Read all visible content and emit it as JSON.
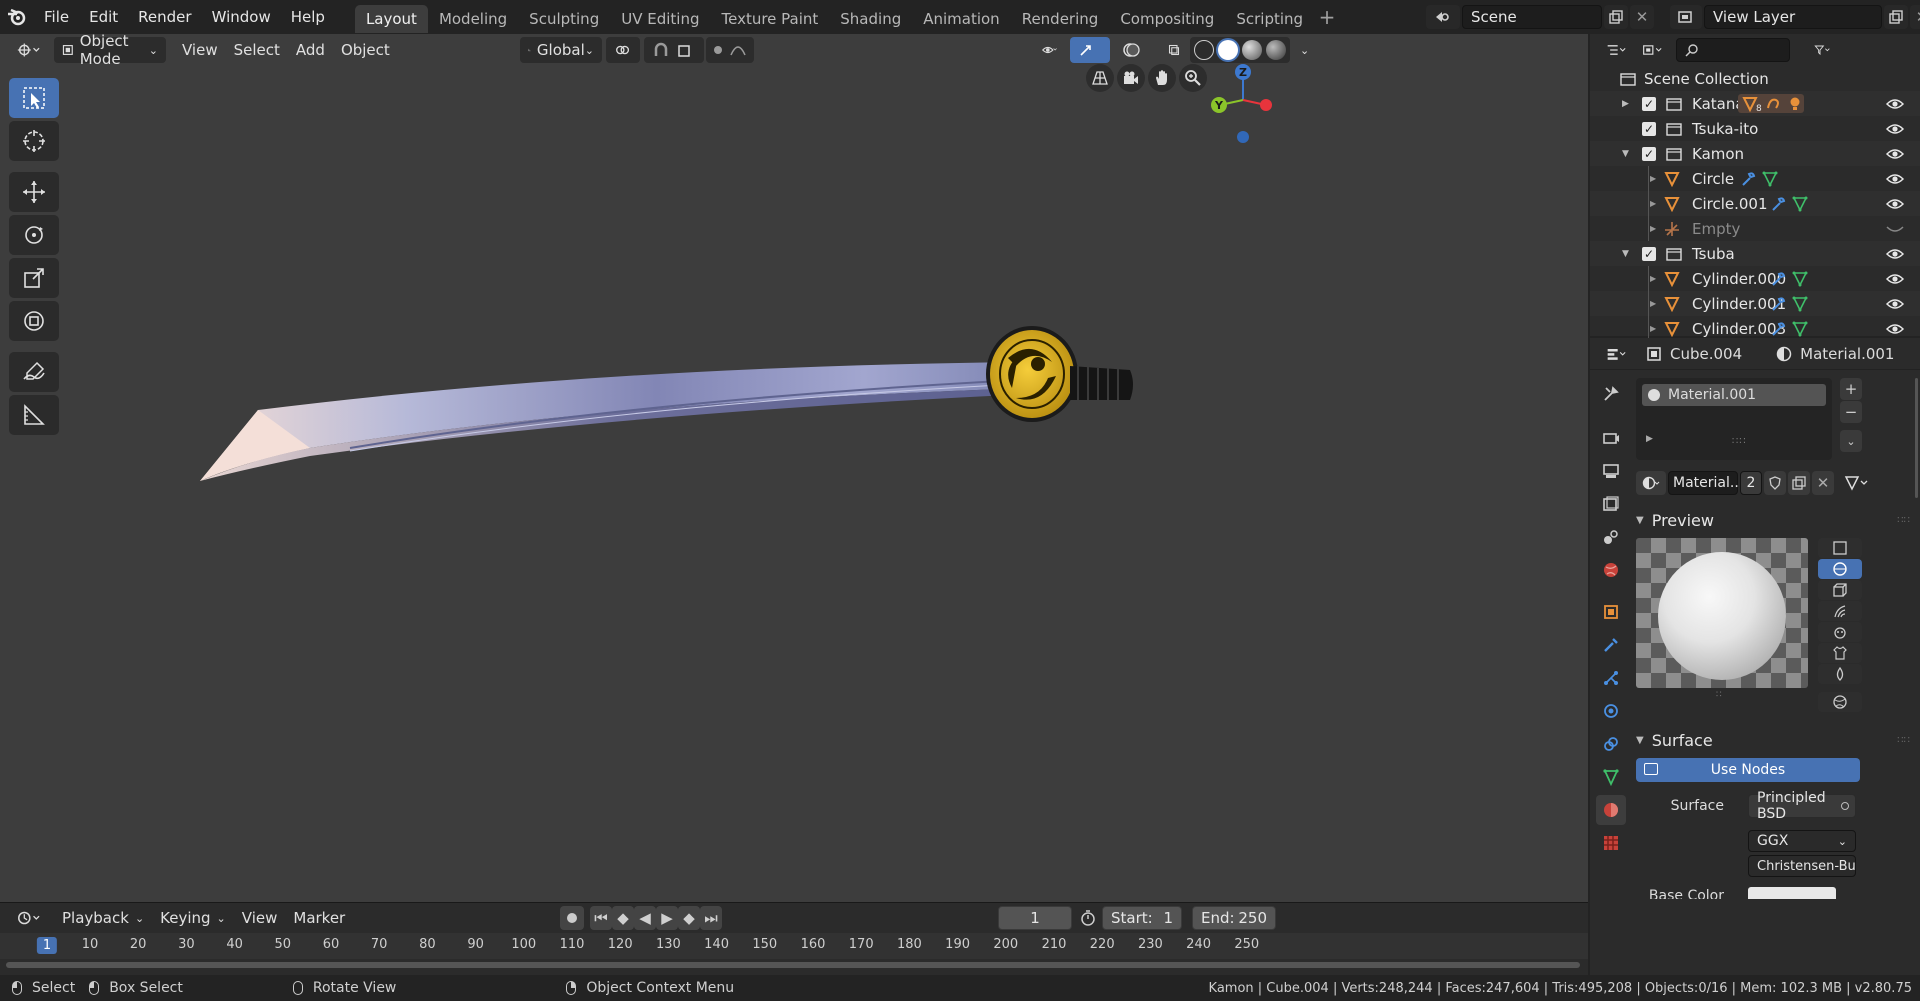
{
  "menus": [
    "File",
    "Edit",
    "Render",
    "Window",
    "Help"
  ],
  "workspaces": [
    "Layout",
    "Modeling",
    "Sculpting",
    "UV Editing",
    "Texture Paint",
    "Shading",
    "Animation",
    "Rendering",
    "Compositing",
    "Scripting"
  ],
  "active_workspace": "Layout",
  "scene": {
    "label": "Scene"
  },
  "view_layer": {
    "label": "View Layer"
  },
  "viewport_header": {
    "mode": "Object Mode",
    "menus": [
      "View",
      "Select",
      "Add",
      "Object"
    ],
    "transform_orientation": "Global"
  },
  "gizmo": {
    "z": "Z",
    "y": "Y"
  },
  "outliner": {
    "root": "Scene Collection",
    "rows": [
      {
        "label": "Katana",
        "level": 0,
        "type": "collection",
        "expand": "closed",
        "badge": "8"
      },
      {
        "label": "Tsuka-ito",
        "level": 0,
        "type": "collection",
        "expand": "none"
      },
      {
        "label": "Kamon",
        "level": 0,
        "type": "collection",
        "expand": "open"
      },
      {
        "label": "Circle",
        "level": 1,
        "type": "mesh"
      },
      {
        "label": "Circle.001",
        "level": 1,
        "type": "mesh"
      },
      {
        "label": "Empty",
        "level": 1,
        "type": "empty"
      },
      {
        "label": "Tsuba",
        "level": 0,
        "type": "collection",
        "expand": "open"
      },
      {
        "label": "Cylinder.000",
        "level": 1,
        "type": "mesh"
      },
      {
        "label": "Cylinder.001",
        "level": 1,
        "type": "mesh"
      },
      {
        "label": "Cylinder.003",
        "level": 1,
        "type": "mesh"
      }
    ]
  },
  "properties": {
    "object": "Cube.004",
    "material": "Material.001",
    "slot": "Material.001",
    "mat_name": "Material...",
    "users": "2",
    "preview_label": "Preview",
    "surface_label": "Surface",
    "use_nodes": "Use Nodes",
    "surface_field_label": "Surface",
    "surface_value": "Principled BSD",
    "distribution": "GGX",
    "subsurface": "Christensen-Bu...",
    "base_color_label": "Base Color"
  },
  "timeline": {
    "menus": [
      "Playback",
      "Keying",
      "View",
      "Marker"
    ],
    "current_frame": "1",
    "start_label": "Start:",
    "start": "1",
    "end_label": "End:",
    "end": "250",
    "ticks": [
      "1",
      "10",
      "20",
      "30",
      "40",
      "50",
      "60",
      "70",
      "80",
      "90",
      "100",
      "110",
      "120",
      "130",
      "140",
      "150",
      "160",
      "170",
      "180",
      "190",
      "200",
      "210",
      "220",
      "230",
      "240",
      "250"
    ]
  },
  "status": {
    "select": "Select",
    "box_select": "Box Select",
    "rotate": "Rotate View",
    "context": "Object Context Menu",
    "info": "Kamon | Cube.004 | Verts:248,244 | Faces:247,604 | Tris:495,208 | Objects:0/16 | Mem: 102.3 MB | v2.80.75"
  },
  "colors": {
    "accent": "#4772b3",
    "viewport_bg": "#3d3d3d",
    "panel_bg": "#2b2b2b",
    "orange": "#e8913a"
  }
}
